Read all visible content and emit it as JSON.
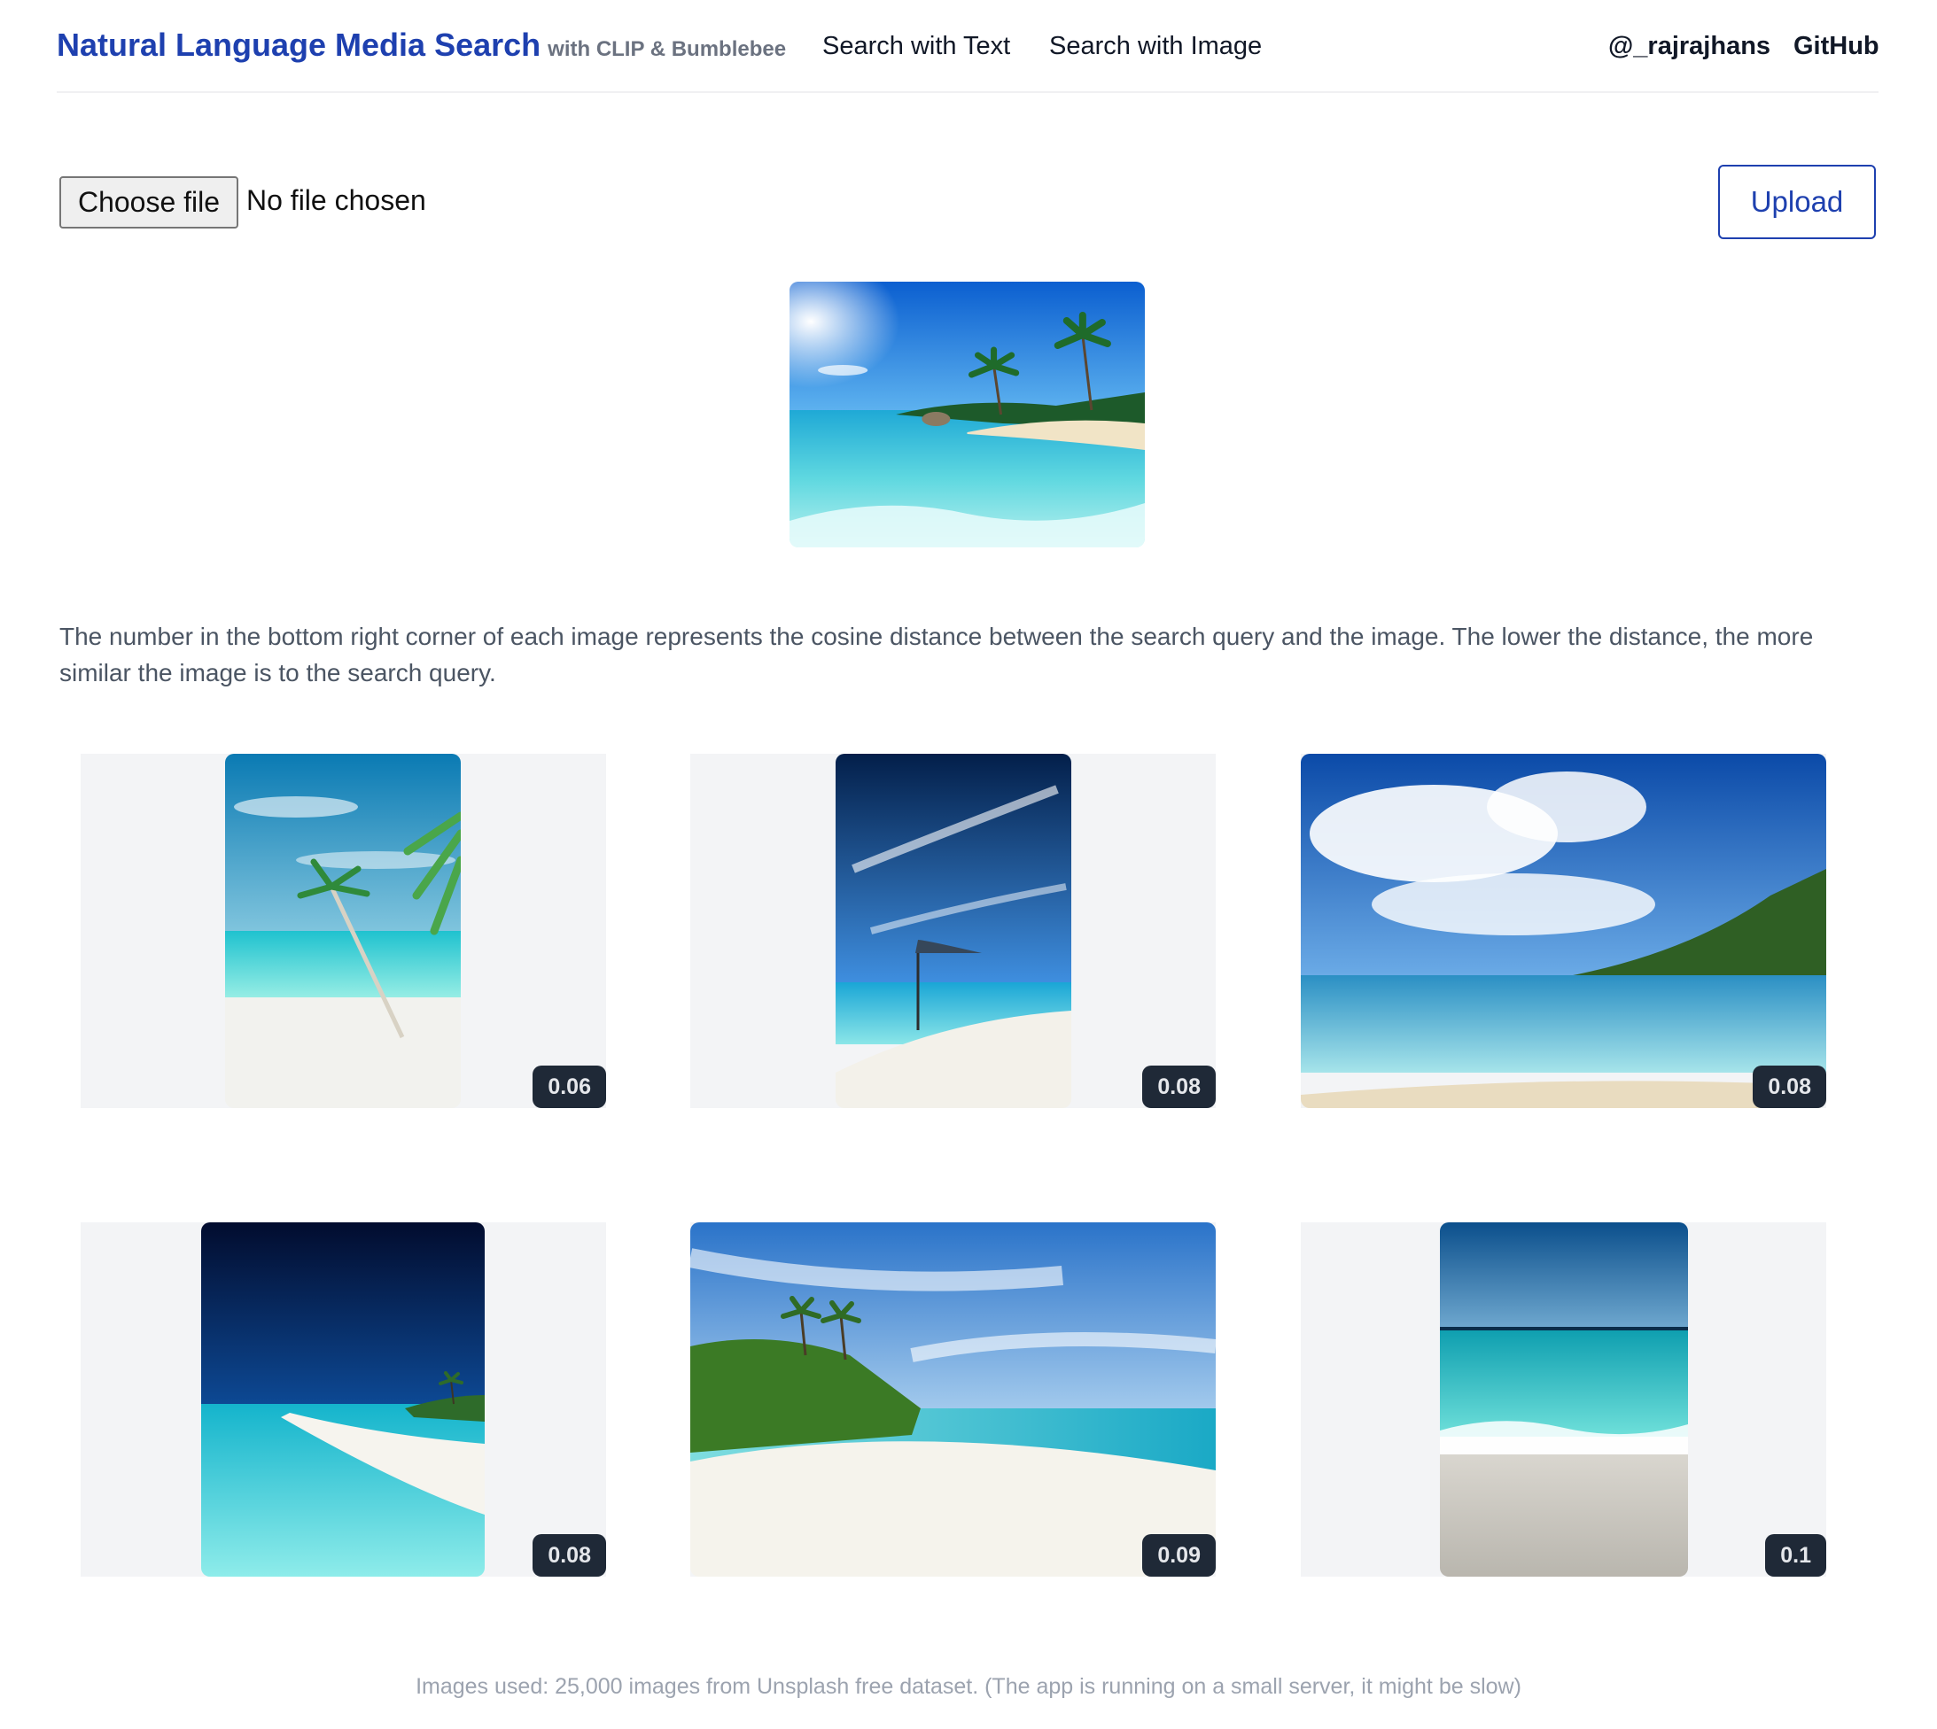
{
  "header": {
    "title": "Natural Language Media Search",
    "subtitle": "with CLIP & Bumblebee",
    "nav": [
      {
        "label": "Search with Text"
      },
      {
        "label": "Search with Image"
      }
    ],
    "right_links": [
      {
        "label": "@_rajrajhans"
      },
      {
        "label": "GitHub"
      }
    ]
  },
  "upload": {
    "file_button_label": "Choose file",
    "file_status": "No file chosen",
    "upload_label": "Upload"
  },
  "description": "The number in the bottom right corner of each image represents the cosine distance between the search query and the image. The lower the distance, the more similar the image is to the search query.",
  "results": [
    {
      "distance": "0.06"
    },
    {
      "distance": "0.08"
    },
    {
      "distance": "0.08"
    },
    {
      "distance": "0.08"
    },
    {
      "distance": "0.09"
    },
    {
      "distance": "0.1"
    }
  ],
  "footer": "Images used: 25,000 images from Unsplash free dataset. (The app is running on a small server, it might be slow)",
  "colors": {
    "brand_blue": "#1e40af",
    "badge_bg": "#1f2937",
    "card_bg": "#f3f4f6"
  }
}
